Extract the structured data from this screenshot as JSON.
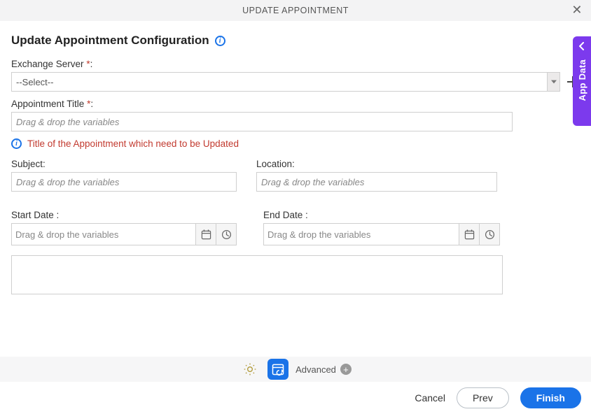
{
  "titlebar": {
    "title": "UPDATE APPOINTMENT"
  },
  "page": {
    "heading": "Update Appointment Configuration"
  },
  "fields": {
    "exchange_server": {
      "label": "Exchange Server ",
      "required_mark": "*",
      "colon": ":",
      "value": "--Select--"
    },
    "appt_title": {
      "label": "Appointment Title ",
      "required_mark": "*",
      "colon": ":",
      "placeholder": "Drag & drop the variables",
      "helper": "Title of the Appointment which need to be Updated"
    },
    "subject": {
      "label": "Subject:",
      "placeholder": "Drag & drop the variables"
    },
    "location": {
      "label": "Location:",
      "placeholder": "Drag & drop the variables"
    },
    "start_date": {
      "label": "Start Date :",
      "placeholder": "Drag & drop the variables"
    },
    "end_date": {
      "label": "End Date :",
      "placeholder": "Drag & drop the variables"
    }
  },
  "bottom_toolbar": {
    "advanced_label": "Advanced"
  },
  "actions": {
    "cancel": "Cancel",
    "prev": "Prev",
    "finish": "Finish"
  },
  "side_panel": {
    "label": "App Data"
  }
}
